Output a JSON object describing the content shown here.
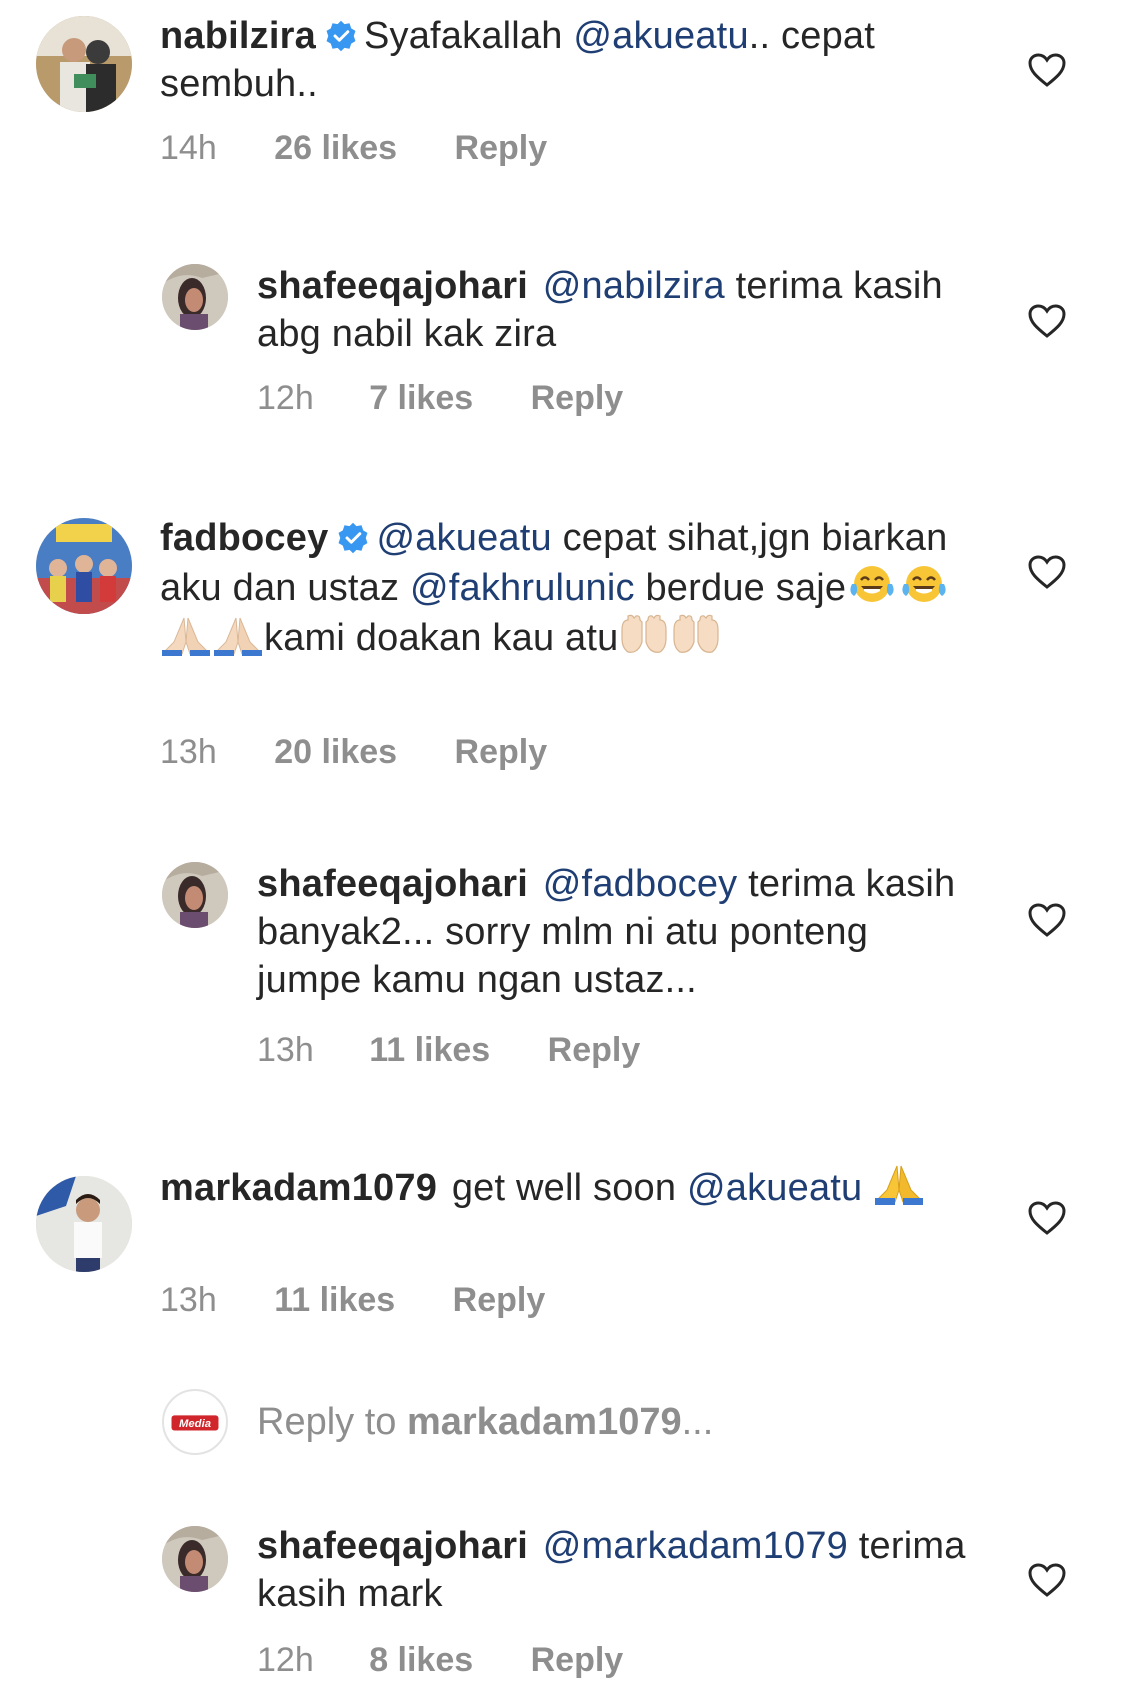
{
  "comments": [
    {
      "username": "nabilzira",
      "verified": true,
      "segments": [
        {
          "text": "Syafakallah ",
          "type": "text"
        },
        {
          "text": "@akueatu",
          "type": "mention"
        },
        {
          "text": ".. cepat sembuh..",
          "type": "text"
        }
      ],
      "time": "14h",
      "likes": "26 likes",
      "reply": "Reply"
    },
    {
      "username": "shafeeqajohari",
      "verified": false,
      "segments": [
        {
          "text": "@nabilzira",
          "type": "mention"
        },
        {
          "text": " terima kasih abg nabil kak zira",
          "type": "text"
        }
      ],
      "time": "12h",
      "likes": "7 likes",
      "reply": "Reply"
    },
    {
      "username": "fadbocey",
      "verified": true,
      "segments": [
        {
          "text": "@akueatu",
          "type": "mention"
        },
        {
          "text": " cepat sihat,jgn biarkan aku dan ustaz ",
          "type": "text"
        },
        {
          "text": "@fakhrulunic",
          "type": "mention"
        },
        {
          "text": " berdue saje",
          "type": "text"
        },
        {
          "text": "",
          "type": "emoji",
          "icon": "tears-of-joy"
        },
        {
          "text": "",
          "type": "emoji",
          "icon": "tears-of-joy"
        },
        {
          "text": "",
          "type": "emoji",
          "icon": "folded-hands-light"
        },
        {
          "text": "",
          "type": "emoji",
          "icon": "folded-hands-light"
        },
        {
          "text": "kami doakan kau atu",
          "type": "text"
        },
        {
          "text": "",
          "type": "emoji",
          "icon": "raised-palms"
        },
        {
          "text": "",
          "type": "emoji",
          "icon": "raised-palms"
        }
      ],
      "time": "13h",
      "likes": "20 likes",
      "reply": "Reply"
    },
    {
      "username": "shafeeqajohari",
      "verified": false,
      "segments": [
        {
          "text": "@fadbocey",
          "type": "mention"
        },
        {
          "text": " terima kasih banyak2... sorry mlm ni atu ponteng jumpe kamu ngan ustaz...",
          "type": "text"
        }
      ],
      "time": "13h",
      "likes": "11 likes",
      "reply": "Reply"
    },
    {
      "username": "markadam1079",
      "verified": false,
      "segments": [
        {
          "text": "get well soon ",
          "type": "text"
        },
        {
          "text": "@akueatu",
          "type": "mention"
        },
        {
          "text": " ",
          "type": "text"
        },
        {
          "text": "",
          "type": "emoji",
          "icon": "folded-hands-yellow"
        }
      ],
      "time": "13h",
      "likes": "11 likes",
      "reply": "Reply"
    },
    {
      "username": "shafeeqajohari",
      "verified": false,
      "segments": [
        {
          "text": "@markadam1079",
          "type": "mention"
        },
        {
          "text": " terima kasih mark",
          "type": "text"
        }
      ],
      "time": "12h",
      "likes": "8 likes",
      "reply": "Reply"
    }
  ],
  "reply_prompt": {
    "prefix": "Reply to ",
    "username": "markadam1079",
    "suffix": "...",
    "avatar_label": "Media"
  },
  "colors": {
    "text": "#262626",
    "mention": "#1f3e73",
    "meta": "#8e8e8e",
    "verified": "#3897f0",
    "media_logo": "#d0262b"
  }
}
